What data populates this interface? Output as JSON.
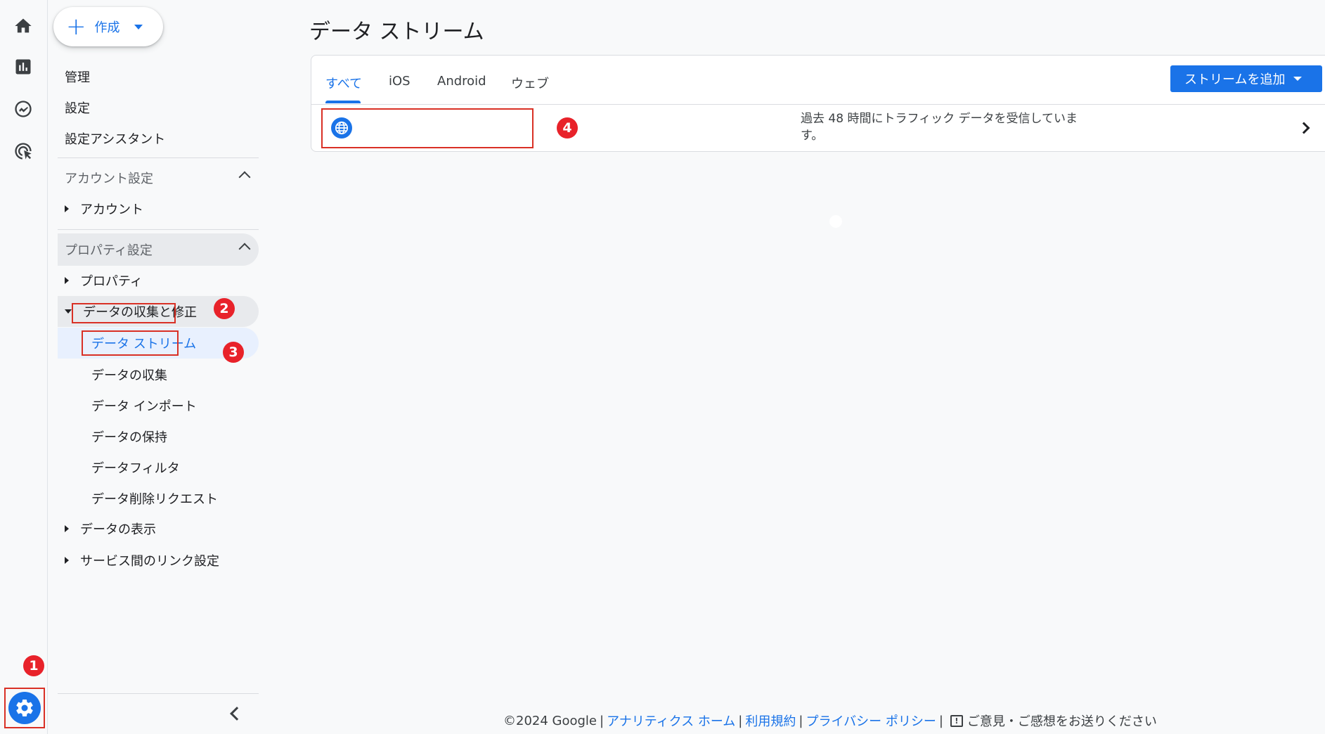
{
  "rail": {
    "items": [
      "home-icon",
      "reports-icon",
      "explore-icon",
      "advertising-icon"
    ],
    "admin": "gear-icon"
  },
  "nav": {
    "create_label": "作成",
    "top_items": [
      "管理",
      "設定",
      "設定アシスタント"
    ],
    "account_section": "アカウント設定",
    "account_item": "アカウント",
    "property_section": "プロパティ設定",
    "property_item": "プロパティ",
    "data_collection": "データの収集と修正",
    "sub_items": [
      "データ ストリーム",
      "データの収集",
      "データ インポート",
      "データの保持",
      "データフィルタ",
      "データ削除リクエスト"
    ],
    "data_display": "データの表示",
    "service_links": "サービス間のリンク設定"
  },
  "main": {
    "title": "データ ストリーム",
    "tabs": [
      "すべて",
      "iOS",
      "Android",
      "ウェブ"
    ],
    "add_stream": "ストリームを追加",
    "stream_status": "過去 48 時間にトラフィック データを受信していま す。"
  },
  "annotations": [
    "1",
    "2",
    "3",
    "4"
  ],
  "footer": {
    "copyright": "©2024 Google",
    "analytics_home": "アナリティクス ホーム",
    "terms": "利用規約",
    "privacy": "プライバシー ポリシー",
    "feedback": "ご意見・ご感想をお送りください"
  },
  "colors": {
    "accent": "#1a73e8",
    "annotation": "#e8222a",
    "highlight_box": "#d93025"
  }
}
